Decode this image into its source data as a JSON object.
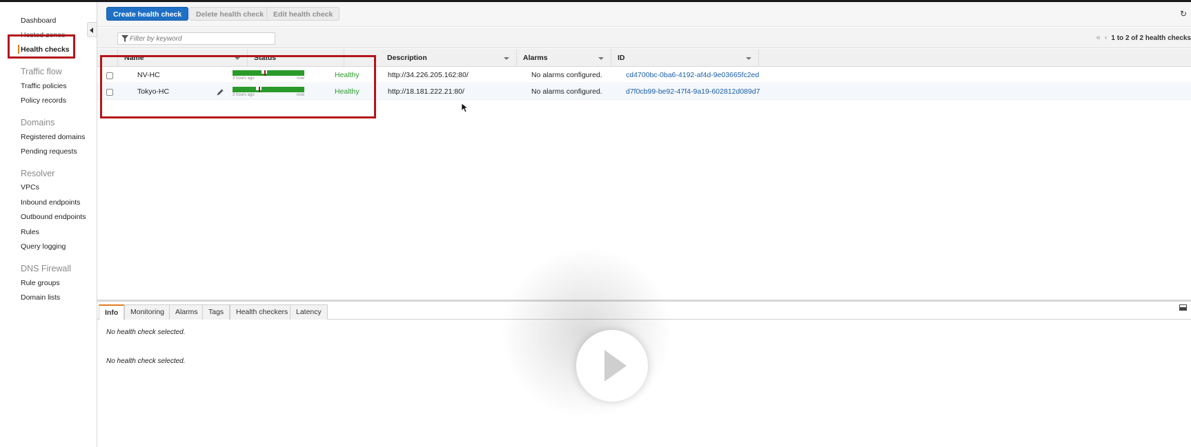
{
  "sidebar": {
    "items": [
      {
        "label": "Dashboard"
      },
      {
        "label": "Hosted zones"
      },
      {
        "label": "Health checks",
        "active": true
      }
    ],
    "sections": [
      {
        "title": "Traffic flow",
        "items": [
          {
            "label": "Traffic policies"
          },
          {
            "label": "Policy records"
          }
        ]
      },
      {
        "title": "Domains",
        "items": [
          {
            "label": "Registered domains"
          },
          {
            "label": "Pending requests"
          }
        ]
      },
      {
        "title": "Resolver",
        "items": [
          {
            "label": "VPCs"
          },
          {
            "label": "Inbound endpoints"
          },
          {
            "label": "Outbound endpoints"
          },
          {
            "label": "Rules"
          },
          {
            "label": "Query logging"
          }
        ]
      },
      {
        "title": "DNS Firewall",
        "items": [
          {
            "label": "Rule groups"
          },
          {
            "label": "Domain lists"
          }
        ]
      }
    ]
  },
  "toolbar": {
    "create_label": "Create health check",
    "delete_label": "Delete health check",
    "edit_label": "Edit health check"
  },
  "filter": {
    "placeholder": "Filter by keyword"
  },
  "pager": {
    "text": "1 to 2 of 2 health checks"
  },
  "table": {
    "columns": [
      {
        "label": "Name"
      },
      {
        "label": "Status"
      },
      {
        "label": "Description"
      },
      {
        "label": "Alarms"
      },
      {
        "label": "ID"
      }
    ],
    "rows": [
      {
        "name": "NV-HC",
        "status": "Healthy",
        "spark_from": "3 hours ago",
        "spark_to": "now",
        "description": "http://34.226.205.162:80/",
        "alarms": "No alarms configured.",
        "id": "cd4700bc-0ba6-4192-af4d-9e03665fc2ed"
      },
      {
        "name": "Tokyo-HC",
        "status": "Healthy",
        "spark_from": "3 hours ago",
        "spark_to": "now",
        "description": "http://18.181.222.21:80/",
        "alarms": "No alarms configured.",
        "id": "d7f0cb99-be92-47f4-9a19-602812d089d7"
      }
    ]
  },
  "details": {
    "tabs": [
      {
        "label": "Info",
        "active": true
      },
      {
        "label": "Monitoring"
      },
      {
        "label": "Alarms"
      },
      {
        "label": "Tags"
      },
      {
        "label": "Health checkers"
      },
      {
        "label": "Latency"
      }
    ],
    "messages": [
      "No health check selected.",
      "No health check selected."
    ]
  },
  "colors": {
    "primary": "#1f6fc5",
    "healthy": "#2a9a2a",
    "annotation": "#b3151b",
    "active_accent": "#e07b1f"
  }
}
